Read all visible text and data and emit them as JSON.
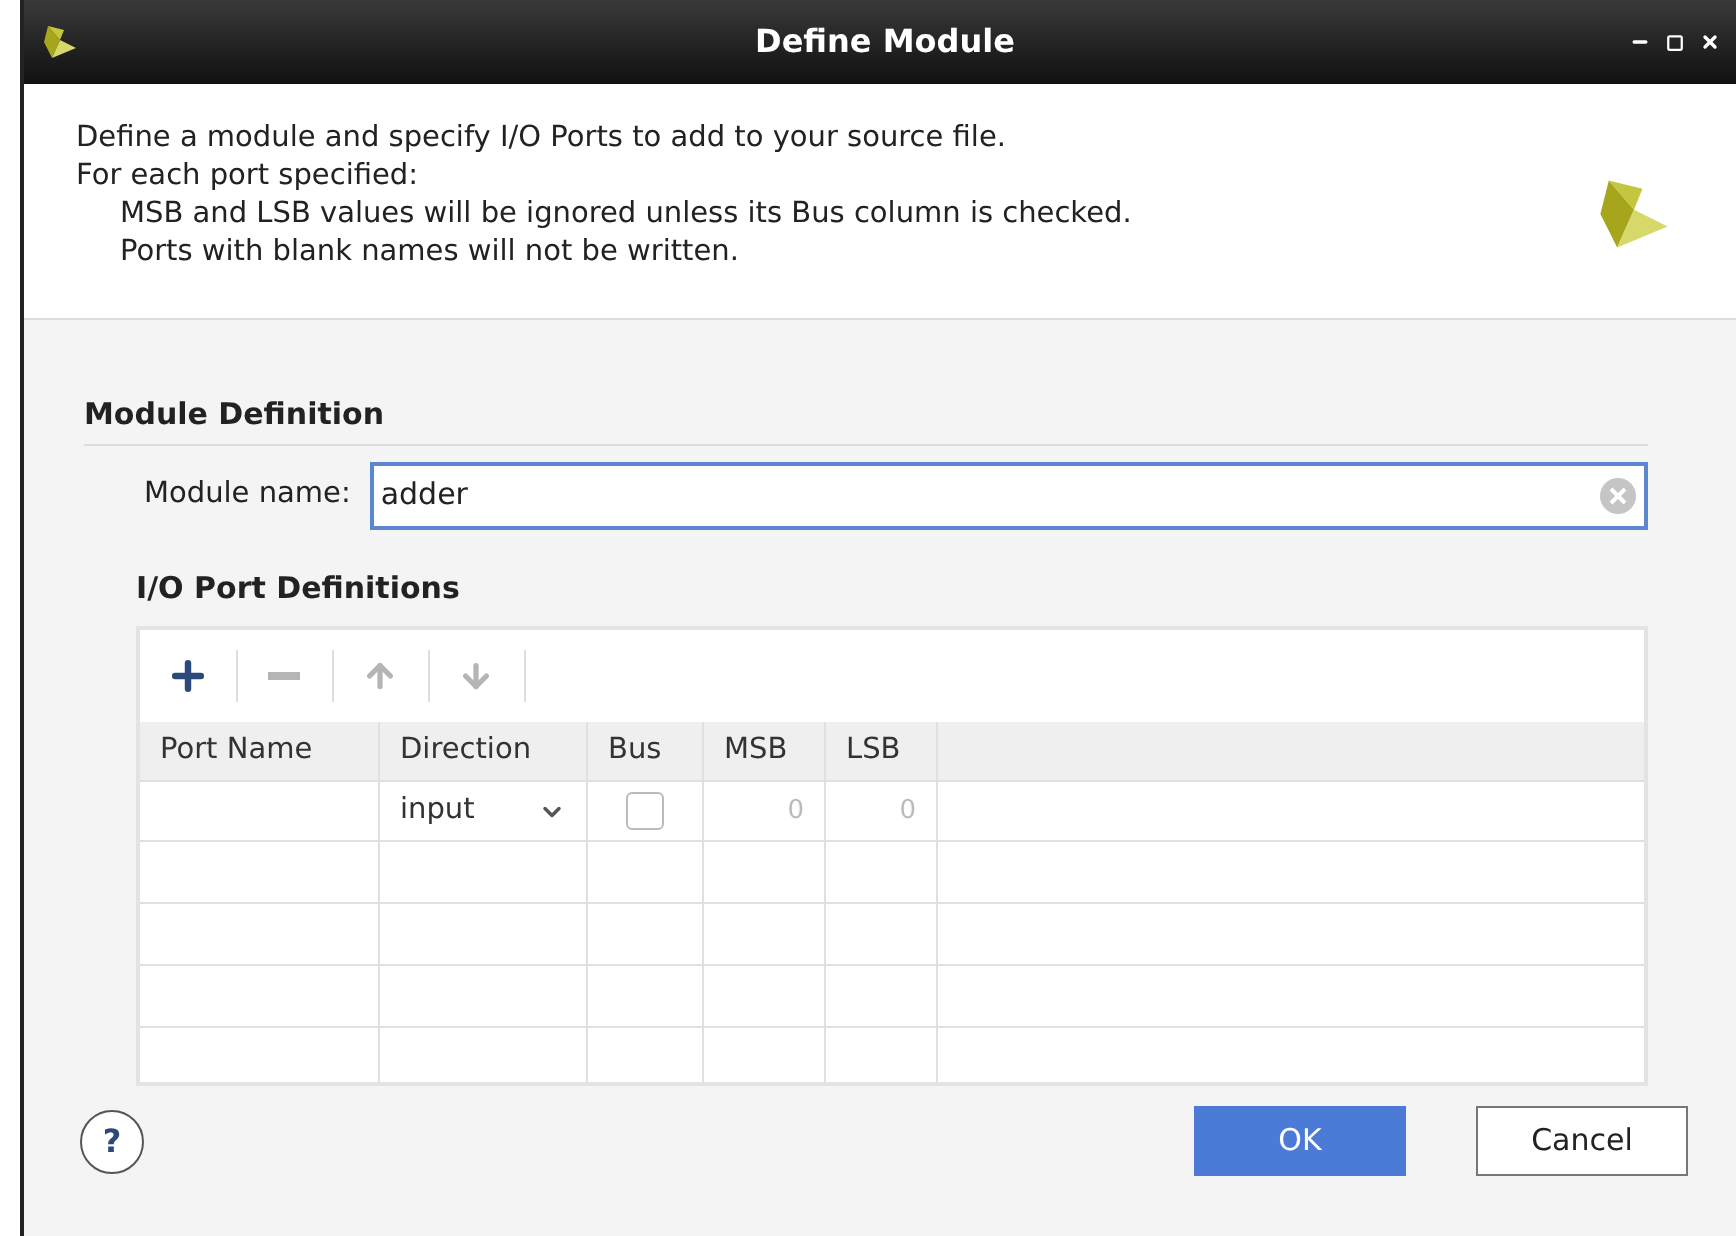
{
  "window": {
    "title": "Define Module"
  },
  "description": {
    "lines": [
      "Define a module and specify I/O Ports to add to your source file.",
      "For each port specified:"
    ],
    "indented_lines": [
      "MSB and LSB values will be ignored unless its Bus column is checked.",
      "Ports with blank names will not be written."
    ]
  },
  "module_definition": {
    "heading": "Module Definition",
    "name_label": "Module name:",
    "name_value": "adder"
  },
  "io_ports": {
    "heading": "I/O Port Definitions",
    "toolbar": [
      {
        "kind": "add",
        "disabled": false
      },
      {
        "kind": "remove",
        "disabled": true
      },
      {
        "kind": "up",
        "disabled": true
      },
      {
        "kind": "down",
        "disabled": true
      }
    ],
    "columns": [
      "Port Name",
      "Direction",
      "Bus",
      "MSB",
      "LSB"
    ],
    "rows": [
      {
        "port_name": "",
        "direction": "input",
        "bus": false,
        "msb": "0",
        "lsb": "0"
      }
    ]
  },
  "help": "?",
  "buttons": [
    {
      "label": "OK",
      "primary": true
    },
    {
      "label": "Cancel",
      "primary": false
    }
  ]
}
